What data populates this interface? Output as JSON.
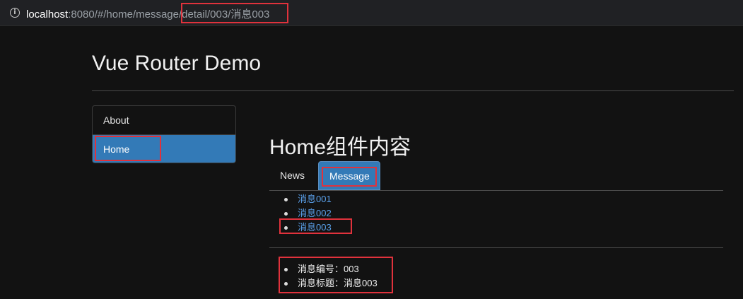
{
  "browser": {
    "url_host": "localhost",
    "url_rest": ":8080/#/home/message/detail/003/消息003"
  },
  "app": {
    "title": "Vue Router Demo"
  },
  "nav": {
    "items": [
      {
        "label": "About"
      },
      {
        "label": "Home"
      }
    ]
  },
  "home": {
    "heading": "Home组件内容",
    "tabs": [
      {
        "label": "News"
      },
      {
        "label": "Message"
      }
    ],
    "messages": [
      {
        "label": "消息001"
      },
      {
        "label": "消息002"
      },
      {
        "label": "消息003"
      }
    ]
  },
  "detail": {
    "id_line": "消息编号：003",
    "title_line": "消息标题：消息003"
  },
  "colors": {
    "accent": "#337ab7",
    "link": "#5aa0ea",
    "highlight": "#e0323c"
  }
}
